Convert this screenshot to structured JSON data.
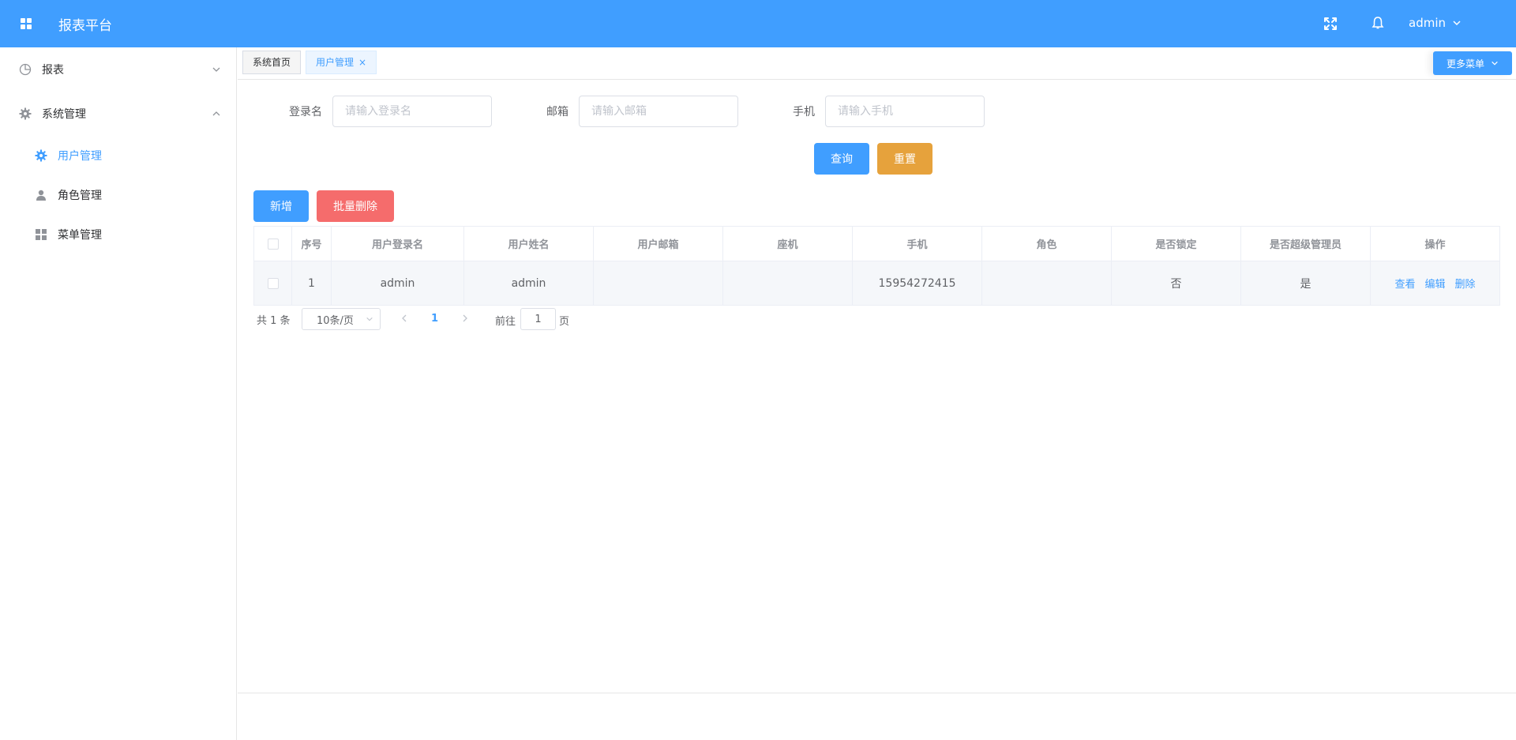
{
  "header": {
    "app_title": "报表平台",
    "user_name": "admin",
    "colors": {
      "primary": "#409eff",
      "warning": "#e6a23c",
      "danger": "#f56c6c"
    }
  },
  "sidebar": {
    "menus": [
      {
        "label": "报表",
        "icon": "pie-chart-icon",
        "expanded": false
      },
      {
        "label": "系统管理",
        "icon": "gear-icon",
        "expanded": true,
        "children": [
          {
            "label": "用户管理",
            "icon": "gear-icon",
            "active": true
          },
          {
            "label": "角色管理",
            "icon": "user-icon",
            "active": false
          },
          {
            "label": "菜单管理",
            "icon": "grid-icon",
            "active": false
          }
        ]
      }
    ]
  },
  "tabs": {
    "items": [
      {
        "label": "系统首页",
        "active": false
      },
      {
        "label": "用户管理",
        "active": true,
        "close": "×"
      }
    ],
    "more_menu": "更多菜单"
  },
  "search": {
    "login_label": "登录名",
    "login_placeholder": "请输入登录名",
    "email_label": "邮箱",
    "email_placeholder": "请输入邮箱",
    "phone_label": "手机",
    "phone_placeholder": "请输入手机",
    "query_label": "查询",
    "reset_label": "重置"
  },
  "actions": {
    "add_label": "新增",
    "batch_delete_label": "批量删除"
  },
  "table": {
    "headers": [
      "序号",
      "用户登录名",
      "用户姓名",
      "用户邮箱",
      "座机",
      "手机",
      "角色",
      "是否锁定",
      "是否超级管理员",
      "操作"
    ],
    "rows": [
      {
        "index": "1",
        "login": "admin",
        "name": "admin",
        "email": "",
        "tel": "",
        "phone": "15954272415",
        "role": "",
        "locked": "否",
        "super_admin": "是"
      }
    ],
    "ops": {
      "view": "查看",
      "edit": "编辑",
      "delete": "删除"
    }
  },
  "pagination": {
    "total": "共 1 条",
    "page_size": "10条/页",
    "current_page": "1",
    "goto_label": "前往",
    "goto_value": "1",
    "page_suffix": "页"
  }
}
